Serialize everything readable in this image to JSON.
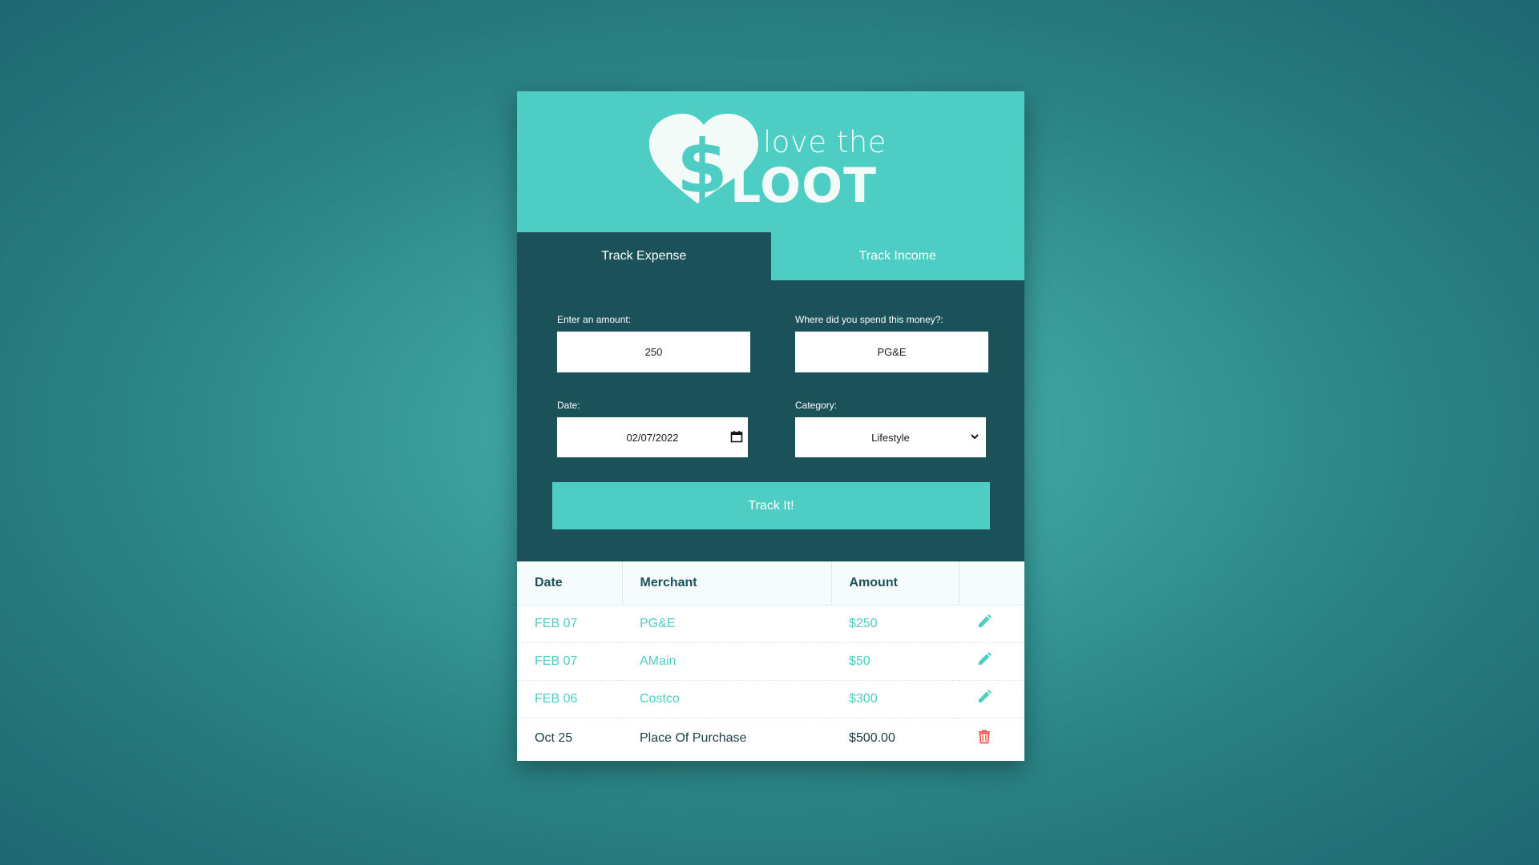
{
  "app": {
    "logo_small": "love the",
    "logo_big": "LOOT"
  },
  "tabs": [
    {
      "label": "Track Expense",
      "active": true
    },
    {
      "label": "Track Income",
      "active": false
    }
  ],
  "form": {
    "amount_label": "Enter an amount:",
    "amount_value": "250",
    "merchant_label": "Where did you spend this money?:",
    "merchant_value": "PG&E",
    "date_label": "Date:",
    "date_value": "02/07/2022",
    "category_label": "Category:",
    "category_value": "Lifestyle",
    "submit_label": "Track It!"
  },
  "table": {
    "headers": [
      "Date",
      "Merchant",
      "Amount"
    ],
    "rows": [
      {
        "date": "FEB 07",
        "merchant": "PG&E",
        "amount": "$250",
        "action_icon": "pencil-icon"
      },
      {
        "date": "FEB 07",
        "merchant": "AMain",
        "amount": "$50",
        "action_icon": "pencil-icon"
      },
      {
        "date": "FEB 06",
        "merchant": "Costco",
        "amount": "$300",
        "action_icon": "pencil-icon"
      },
      {
        "date": "Oct 25",
        "merchant": "Place Of Purchase",
        "amount": "$500.00",
        "action_icon": "trash-icon"
      }
    ]
  },
  "colors": {
    "accent": "#4ecdc4",
    "dark": "#1b525a",
    "danger": "#f0524f"
  }
}
